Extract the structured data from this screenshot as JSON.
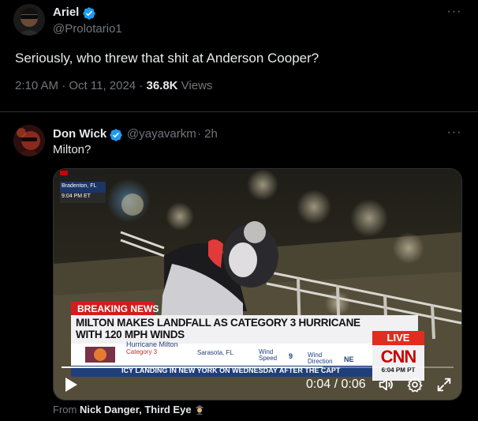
{
  "tweet": {
    "author": {
      "name": "Ariel",
      "handle": "@Prolotario1"
    },
    "text": "Seriously, who threw that shit at Anderson Cooper?",
    "time": "2:10 AM · Oct 11, 2024 · ",
    "views_count": "36.8K",
    "views_label": " Views"
  },
  "quote": {
    "author": {
      "name": "Don Wick",
      "handle": "@yayavarkm",
      "age": "· 2h"
    },
    "text": "Milton?",
    "video": {
      "location_bug": {
        "city": "Bradenton, FL",
        "time": "9:04 PM ET"
      },
      "breaking_label": "BREAKING NEWS",
      "headline": "MILTON MAKES LANDFALL AS CATEGORY 3 HURRICANE WITH 120 MPH WINDS",
      "live_label": "LIVE",
      "network": "CNN",
      "clock": "6:04 PM PT",
      "info": {
        "storm_name": "Hurricane Milton",
        "category": "Category 3",
        "city": "Sarasota, FL",
        "wind_speed_label": "Wind Speed",
        "wind_speed_value": "9",
        "wind_dir_label": "Wind Direction",
        "wind_dir_value": "NE"
      },
      "ticker": "ICY LANDING IN NEW YORK ON WEDNESDAY AFTER THE CAPT",
      "time_display": "0:04 / 0:06",
      "progress": 0.667
    },
    "from_prefix": "From ",
    "from_source": "Nick Danger, Third Eye"
  },
  "colors": {
    "accent_blue": "#1d9bf0",
    "cnn_red": "#cc0000",
    "breaking_red": "#d41c1c"
  }
}
